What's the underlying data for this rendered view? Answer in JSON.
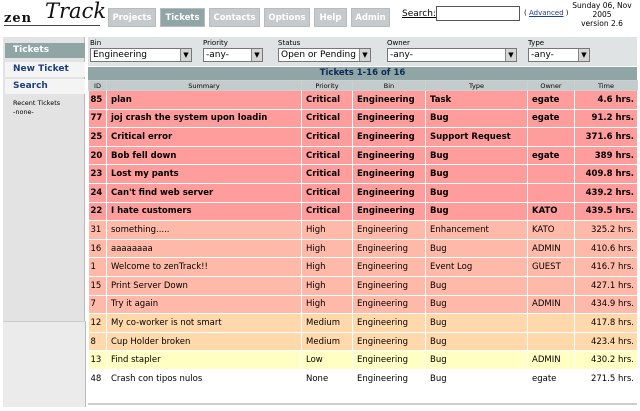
{
  "app": {
    "logo_left": "zen",
    "logo_right": "Track"
  },
  "nav": {
    "tabs": [
      {
        "label": "Projects",
        "active": false
      },
      {
        "label": "Tickets",
        "active": true
      },
      {
        "label": "Contacts",
        "active": false
      },
      {
        "label": "Options",
        "active": false
      },
      {
        "label": "Help",
        "active": false
      },
      {
        "label": "Admin",
        "active": false
      }
    ]
  },
  "search": {
    "label": "Search:",
    "value": "",
    "advanced_open": "(",
    "advanced_label": "Advanced",
    "advanced_close": ")"
  },
  "date": {
    "line1": "Sunday 06, Nov",
    "line2": "2005",
    "line3": "version 2.6"
  },
  "sidebar": {
    "items": [
      {
        "label": "Tickets",
        "active": true
      },
      {
        "label": "New Ticket",
        "active": false
      },
      {
        "label": "Search",
        "active": false
      }
    ],
    "recent_title": "Recent Tickets",
    "recent_none": "-none-"
  },
  "filters": {
    "bin": {
      "label": "Bin",
      "value": "Engineering"
    },
    "priority": {
      "label": "Priority",
      "value": "-any-"
    },
    "status": {
      "label": "Status",
      "value": "Open or Pending"
    },
    "owner": {
      "label": "Owner",
      "value": "-any-"
    },
    "type": {
      "label": "Type",
      "value": "-any-"
    }
  },
  "list": {
    "title": "Tickets 1-16 of 16",
    "columns": [
      "ID",
      "Summary",
      "Priority",
      "Bin",
      "Type",
      "Owner",
      "Time"
    ],
    "rows": [
      {
        "id": "85",
        "summary": "plan",
        "priority": "Critical",
        "bin": "Engineering",
        "type": "Task",
        "owner": "egate",
        "time": "4.6 hrs.",
        "level": "critical"
      },
      {
        "id": "77",
        "summary": "joj crash the system upon loadin",
        "priority": "Critical",
        "bin": "Engineering",
        "type": "Bug",
        "owner": "egate",
        "time": "91.2 hrs.",
        "level": "critical"
      },
      {
        "id": "25",
        "summary": "Critical error",
        "priority": "Critical",
        "bin": "Engineering",
        "type": "Support Request",
        "owner": "",
        "time": "371.6 hrs.",
        "level": "critical"
      },
      {
        "id": "20",
        "summary": "Bob fell down",
        "priority": "Critical",
        "bin": "Engineering",
        "type": "Bug",
        "owner": "egate",
        "time": "389 hrs.",
        "level": "critical"
      },
      {
        "id": "23",
        "summary": "Lost my pants",
        "priority": "Critical",
        "bin": "Engineering",
        "type": "Bug",
        "owner": "",
        "time": "409.8 hrs.",
        "level": "critical"
      },
      {
        "id": "24",
        "summary": "Can't find web server",
        "priority": "Critical",
        "bin": "Engineering",
        "type": "Bug",
        "owner": "",
        "time": "439.2 hrs.",
        "level": "critical"
      },
      {
        "id": "22",
        "summary": "I hate customers",
        "priority": "Critical",
        "bin": "Engineering",
        "type": "Bug",
        "owner": "KATO",
        "time": "439.5 hrs.",
        "level": "critical"
      },
      {
        "id": "31",
        "summary": "something.....",
        "priority": "High",
        "bin": "Engineering",
        "type": "Enhancement",
        "owner": "KATO",
        "time": "325.2 hrs.",
        "level": "high"
      },
      {
        "id": "16",
        "summary": "aaaaaaaa",
        "priority": "High",
        "bin": "Engineering",
        "type": "Bug",
        "owner": "ADMIN",
        "time": "410.6 hrs.",
        "level": "high"
      },
      {
        "id": "1",
        "summary": "Welcome to zenTrack!!",
        "priority": "High",
        "bin": "Engineering",
        "type": "Event Log",
        "owner": "GUEST",
        "time": "416.7 hrs.",
        "level": "high"
      },
      {
        "id": "15",
        "summary": "Print Server Down",
        "priority": "High",
        "bin": "Engineering",
        "type": "Bug",
        "owner": "",
        "time": "427.1 hrs.",
        "level": "high"
      },
      {
        "id": "7",
        "summary": "Try it again",
        "priority": "High",
        "bin": "Engineering",
        "type": "Bug",
        "owner": "ADMIN",
        "time": "434.9 hrs.",
        "level": "high"
      },
      {
        "id": "12",
        "summary": "My co-worker is not smart",
        "priority": "Medium",
        "bin": "Engineering",
        "type": "Bug",
        "owner": "",
        "time": "417.8 hrs.",
        "level": "medium"
      },
      {
        "id": "8",
        "summary": "Cup Holder broken",
        "priority": "Medium",
        "bin": "Engineering",
        "type": "Bug",
        "owner": "",
        "time": "423.4 hrs.",
        "level": "medium"
      },
      {
        "id": "13",
        "summary": "Find stapler",
        "priority": "Low",
        "bin": "Engineering",
        "type": "Bug",
        "owner": "ADMIN",
        "time": "430.2 hrs.",
        "level": "low"
      },
      {
        "id": "48",
        "summary": "Crash con tipos nulos",
        "priority": "None",
        "bin": "Engineering",
        "type": "Bug",
        "owner": "egate",
        "time": "271.5 hrs.",
        "level": "none"
      }
    ]
  },
  "colors": {
    "accent": "#8fa5a6",
    "critical_row": "#ff9c9c",
    "high_row": "#ffb9a8",
    "medium_row": "#ffd9ab",
    "low_row": "#ffffc4",
    "none_row": "#ffffff"
  }
}
